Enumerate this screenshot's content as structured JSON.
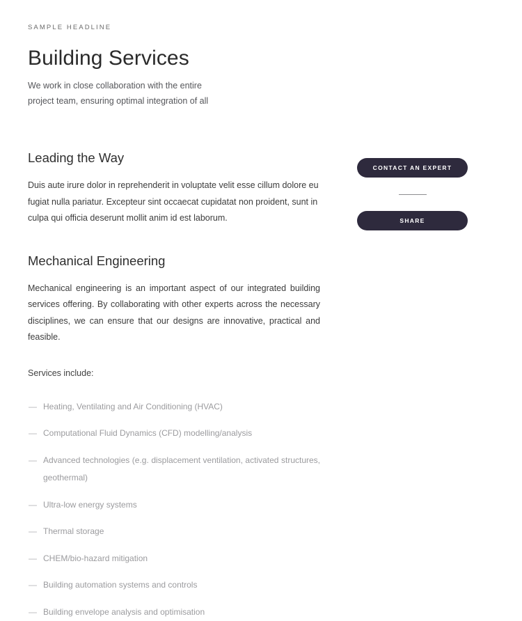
{
  "header": {
    "eyebrow": "SAMPLE HEADLINE",
    "title": "Building Services",
    "subtitle": "We work in close collaboration with the entire project team, ensuring optimal integration of all"
  },
  "sections": [
    {
      "heading": "Leading the Way",
      "paragraph": "Duis aute irure dolor in reprehenderit in voluptate velit esse cillum dolore eu fugiat nulla pariatur. Excepteur sint occaecat cupidatat non proident, sunt in culpa qui officia deserunt mollit anim id est laborum."
    },
    {
      "heading": "Mechanical Engineering",
      "paragraph": "Mechanical engineering is an important aspect of our integrated building services offering. By collaborating with other experts across the necessary disciplines, we can ensure that our designs are innovative, practical and feasible."
    }
  ],
  "services": {
    "intro": "Services include:",
    "marker": "—",
    "items": [
      "Heating, Ventilating and Air Conditioning (HVAC)",
      "Computational Fluid Dynamics (CFD) modelling/analysis",
      "Advanced technologies (e.g. displacement ventilation, activated structures, geothermal)",
      "Ultra-low energy systems",
      "Thermal storage",
      "CHEM/bio-hazard mitigation",
      "Building automation systems and controls",
      "Building envelope analysis and optimisation"
    ]
  },
  "actions": {
    "contact_label": "CONTACT AN EXPERT",
    "share_label": "SHARE"
  },
  "colors": {
    "button_bg": "#2e2a3d",
    "button_text": "#ffffff",
    "page_bg": "#ffffff",
    "heading_text": "#2b2b2b",
    "body_text": "#3c3c3c",
    "muted_text": "#9b9b9e",
    "eyebrow_text": "#6b6b6b",
    "divider": "#8c8c90"
  }
}
